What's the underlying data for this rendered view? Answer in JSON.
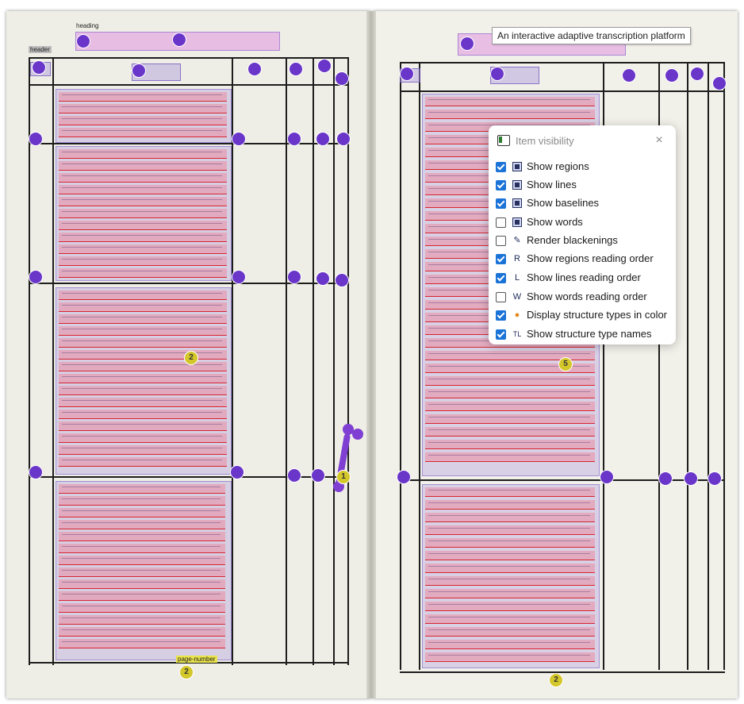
{
  "tooltip": {
    "text": "An interactive adaptive transcription platform"
  },
  "panel": {
    "title": "Item visibility",
    "close_label": "×",
    "options": [
      {
        "label": "Show regions",
        "checked": true,
        "icon": "regions-icon"
      },
      {
        "label": "Show lines",
        "checked": true,
        "icon": "lines-icon"
      },
      {
        "label": "Show baselines",
        "checked": true,
        "icon": "baselines-icon"
      },
      {
        "label": "Show words",
        "checked": false,
        "icon": "words-icon"
      },
      {
        "label": "Render blackenings",
        "checked": false,
        "icon": "blackenings-icon"
      },
      {
        "label": "Show regions reading order",
        "checked": true,
        "icon": "regions-reading-order-icon"
      },
      {
        "label": "Show lines reading order",
        "checked": true,
        "icon": "lines-reading-order-icon"
      },
      {
        "label": "Show words reading order",
        "checked": false,
        "icon": "words-reading-order-icon"
      },
      {
        "label": "Display structure types in color",
        "checked": true,
        "icon": "palette-icon"
      },
      {
        "label": "Show structure type names",
        "checked": true,
        "icon": "structure-names-icon"
      }
    ]
  },
  "document": {
    "left_tags": {
      "heading": "heading",
      "header": "header",
      "page_number": "page-number"
    },
    "markers": {
      "region_yellow_left": "2",
      "region_yellow_right": "5",
      "page_marker_left": "2",
      "page_marker_right": "2",
      "handle_marker": "1"
    }
  }
}
